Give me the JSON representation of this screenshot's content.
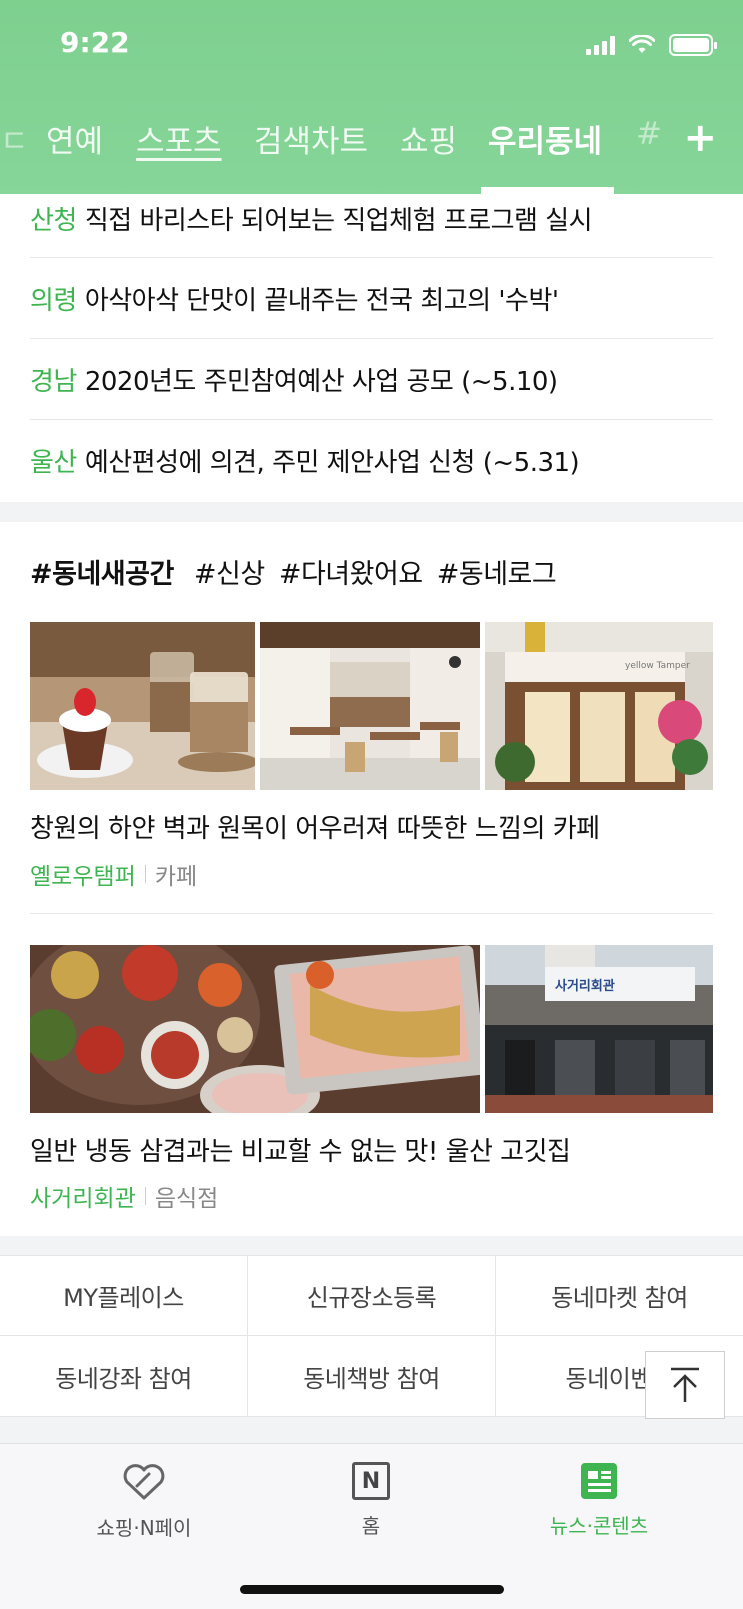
{
  "status_bar": {
    "time": "9:22"
  },
  "tabs": [
    {
      "label": "연예"
    },
    {
      "label": "스포츠"
    },
    {
      "label": "검색차트"
    },
    {
      "label": "쇼핑"
    },
    {
      "label": "우리동네"
    },
    {
      "label": "#"
    }
  ],
  "add_tab_label": "+",
  "news": [
    {
      "region": "산청",
      "title": "직접 바리스타 되어보는 직업체험 프로그램 실시"
    },
    {
      "region": "의령",
      "title": "아삭아삭 단맛이 끝내주는 전국 최고의 '수박'"
    },
    {
      "region": "경남",
      "title": "2020년도 주민참여예산 사업 공모 (~5.10)"
    },
    {
      "region": "울산",
      "title": "예산편성에 의견, 주민 제안사업 신청 (~5.31)"
    }
  ],
  "hashtags": {
    "main": "#동네새공간",
    "tags": [
      "#신상",
      "#다녀왔어요",
      "#동네로그"
    ]
  },
  "cards": [
    {
      "title": "창원의 하얀 벽과 원목이 어우러져 따뜻한 느낌의 카페",
      "place": "옐로우탬퍼",
      "category": "카페"
    },
    {
      "title": "일반 냉동 삼겹과는 비교할 수 없는 맛! 울산 고깃집",
      "place": "사거리회관",
      "category": "음식점"
    }
  ],
  "photo_signs": {
    "cafe_sign": "yellow Tamper",
    "restaurant_sign": "사거리회관"
  },
  "quick_links": [
    [
      "MY플레이스",
      "신규장소등록",
      "동네마켓 참여"
    ],
    [
      "동네강좌 참여",
      "동네책방 참여",
      "동네이벤트"
    ]
  ],
  "bottom_nav": [
    {
      "label": "쇼핑·N페이",
      "icon": "heart-pay-icon"
    },
    {
      "label": "홈",
      "icon": "n-logo-icon",
      "glyph": "N"
    },
    {
      "label": "뉴스·콘텐츠",
      "icon": "news-icon"
    }
  ],
  "colors": {
    "header_green": "#7ed08f",
    "accent_green": "#3fb552"
  }
}
